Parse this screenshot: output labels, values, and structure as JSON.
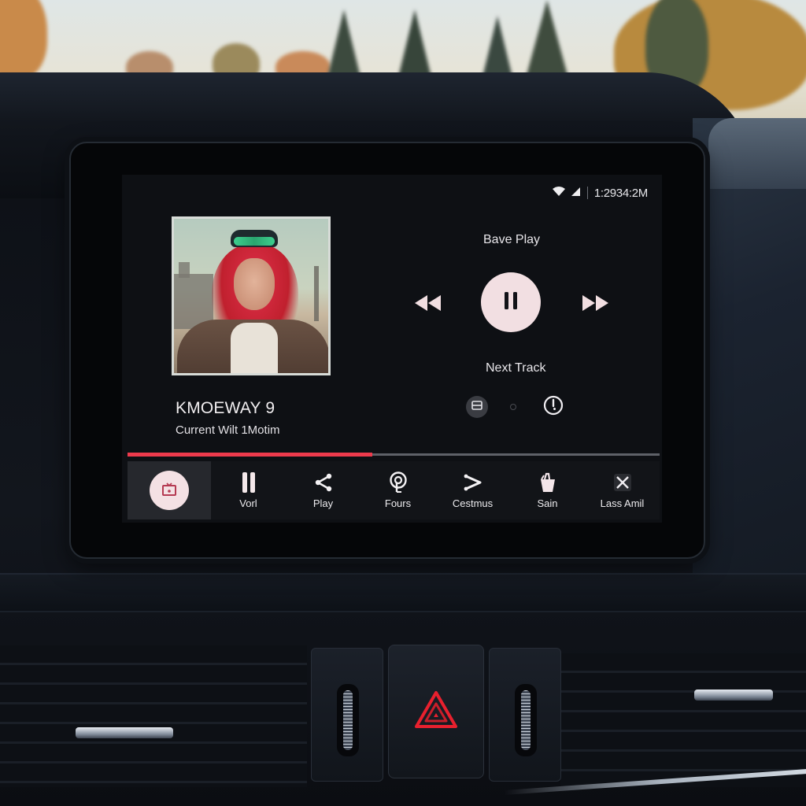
{
  "scene": {
    "description": "car dashboard infotainment screen, outdoor autumn trees behind windshield",
    "hazard_icon": "hazard-triangle-icon",
    "hazard_color": "#e8202e"
  },
  "status_bar": {
    "wifi_icon": "wifi-icon",
    "signal_icon": "cellular-signal-icon",
    "time": "1:2934:2M"
  },
  "now_playing": {
    "album_art_alt": "album cover portrait of red-haired woman with green sunglasses",
    "title": "KMOEWAY 9",
    "subtitle": "Current Wilt 1Motim",
    "mode_label": "Bave Play",
    "next_track_label": "Next Track",
    "controls": {
      "previous_icon": "rewind-icon",
      "play_pause_icon": "pause-icon",
      "next_icon": "fast-forward-icon",
      "play_button_color": "#f2dfe2"
    },
    "aux_buttons": [
      {
        "icon": "equalizer-icon"
      },
      {
        "icon": "dot-indicator-icon"
      },
      {
        "icon": "power-timer-icon"
      }
    ],
    "progress": {
      "fraction": 0.46,
      "fill_color": "#ee3a4c",
      "track_color": "#5e6168"
    }
  },
  "nav_bar": {
    "items": [
      {
        "label": "",
        "icon": "media-home-icon",
        "active": true
      },
      {
        "label": "Vorl",
        "icon": "pause-icon",
        "active": false
      },
      {
        "label": "Play",
        "icon": "share-icon",
        "active": false
      },
      {
        "label": "Fours",
        "icon": "location-pin-icon",
        "active": false
      },
      {
        "label": "Cestmus",
        "icon": "chevron-right-icon",
        "active": false
      },
      {
        "label": "Sain",
        "icon": "bag-icon",
        "active": false
      },
      {
        "label": "Lass Amil",
        "icon": "close-icon",
        "active": false
      }
    ]
  }
}
